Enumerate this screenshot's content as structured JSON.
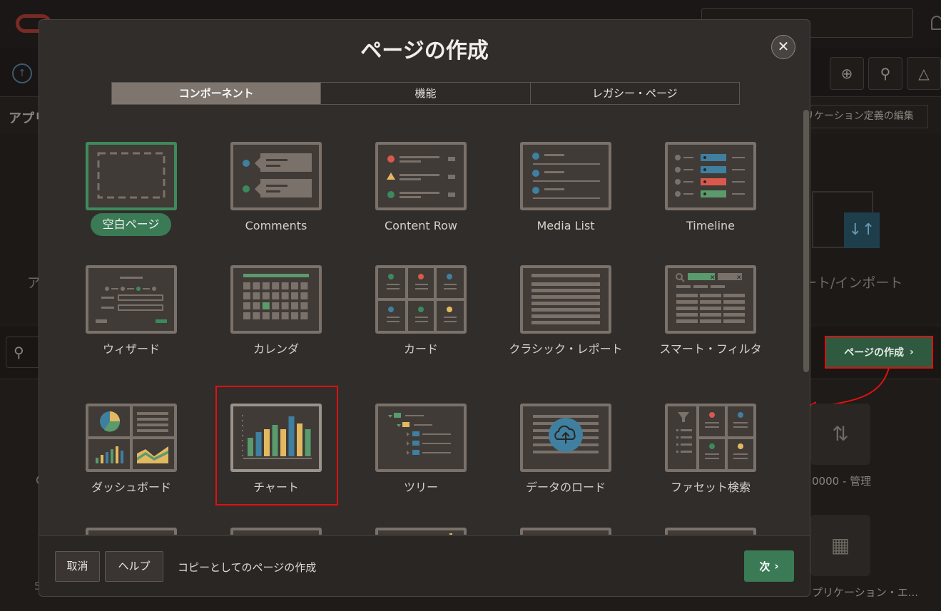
{
  "background": {
    "import_label": "ート/インポート",
    "left_fragment_1": "ア",
    "edit_button": "リケーション定義の編集",
    "create_page_button": "ページの作成",
    "tile_1_label": "0000 - 管理",
    "tile_2_label": "プリケーション・エ...",
    "left_fragment_2": "C",
    "left_fragment_3": "5",
    "title_fragment": "アプリ"
  },
  "modal": {
    "title": "ページの作成",
    "close_glyph": "✕",
    "tabs": [
      {
        "label": "コンポーネント",
        "active": true
      },
      {
        "label": "機能",
        "active": false
      },
      {
        "label": "レガシー・ページ",
        "active": false
      }
    ],
    "cards": [
      {
        "label": "空白ページ",
        "icon": "blank-page-icon"
      },
      {
        "label": "Comments",
        "icon": "comments-icon"
      },
      {
        "label": "Content Row",
        "icon": "content-row-icon"
      },
      {
        "label": "Media List",
        "icon": "media-list-icon"
      },
      {
        "label": "Timeline",
        "icon": "timeline-icon"
      },
      {
        "label": "ウィザード",
        "icon": "wizard-icon"
      },
      {
        "label": "カレンダ",
        "icon": "calendar-icon"
      },
      {
        "label": "カード",
        "icon": "cards-icon"
      },
      {
        "label": "クラシック・レポート",
        "icon": "classic-report-icon"
      },
      {
        "label": "スマート・フィルタ",
        "icon": "smart-filter-icon"
      },
      {
        "label": "ダッシュボード",
        "icon": "dashboard-icon"
      },
      {
        "label": "チャート",
        "icon": "chart-icon"
      },
      {
        "label": "ツリー",
        "icon": "tree-icon"
      },
      {
        "label": "データのロード",
        "icon": "data-load-icon"
      },
      {
        "label": "ファセット検索",
        "icon": "faceted-search-icon"
      }
    ],
    "footer": {
      "cancel": "取消",
      "help": "ヘルプ",
      "copy_link": "コピーとしてのページの作成",
      "next": "次"
    }
  },
  "colors": {
    "accent_green": "#3a7a54",
    "highlight_red": "#e01010",
    "blue": "#3f7fa0",
    "yellow": "#e2b860",
    "red": "#d9594c"
  }
}
